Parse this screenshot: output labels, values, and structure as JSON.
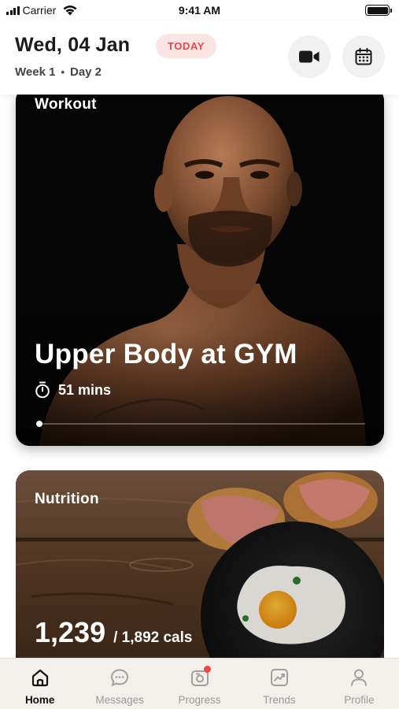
{
  "status_bar": {
    "carrier": "Carrier",
    "time": "9:41 AM"
  },
  "header": {
    "date": "Wed, 04 Jan",
    "today_badge": "TODAY",
    "week": "Week 1",
    "separator": "•",
    "day": "Day 2",
    "video_icon": "video-camera-icon",
    "calendar_icon": "calendar-icon"
  },
  "workout": {
    "label": "Workout",
    "title": "Upper Body at GYM",
    "duration": "51 mins",
    "progress": 0.01
  },
  "nutrition": {
    "label": "Nutrition",
    "calories": "1,239",
    "goal": "/ 1,892 cals"
  },
  "tabs": [
    {
      "label": "Home",
      "icon": "home-icon",
      "active": true
    },
    {
      "label": "Messages",
      "icon": "chat-bubble-icon",
      "active": false
    },
    {
      "label": "Progress",
      "icon": "camera-icon",
      "active": false,
      "badge": true
    },
    {
      "label": "Trends",
      "icon": "trend-chart-icon",
      "active": false
    },
    {
      "label": "Profile",
      "icon": "user-icon",
      "active": false
    }
  ],
  "colors": {
    "accent_red": "#e54848",
    "badge_bg": "#fbe4e4",
    "tab_bar_bg": "#f3efeb",
    "inactive_tab": "#9a9a9a"
  }
}
